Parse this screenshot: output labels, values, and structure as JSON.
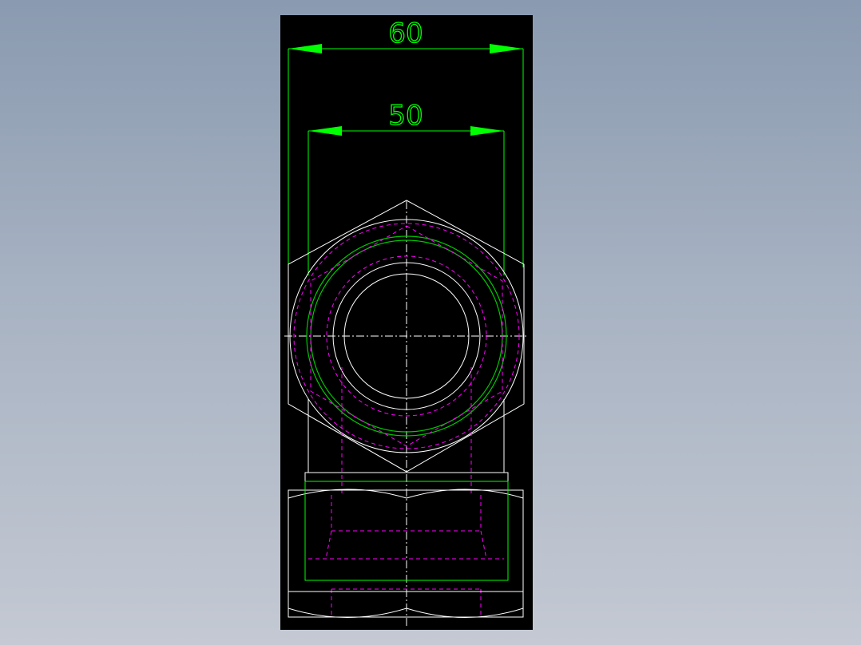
{
  "dimensions": {
    "outer": {
      "value": "60"
    },
    "inner": {
      "value": "50"
    }
  },
  "colors": {
    "background_top": "#8a9ab0",
    "background_bottom": "#c4c9d3",
    "panel": "#000000",
    "dimension": "#00ff00",
    "outline": "#ffffff",
    "hidden": "#ff00ff",
    "thread": "#00c800"
  }
}
